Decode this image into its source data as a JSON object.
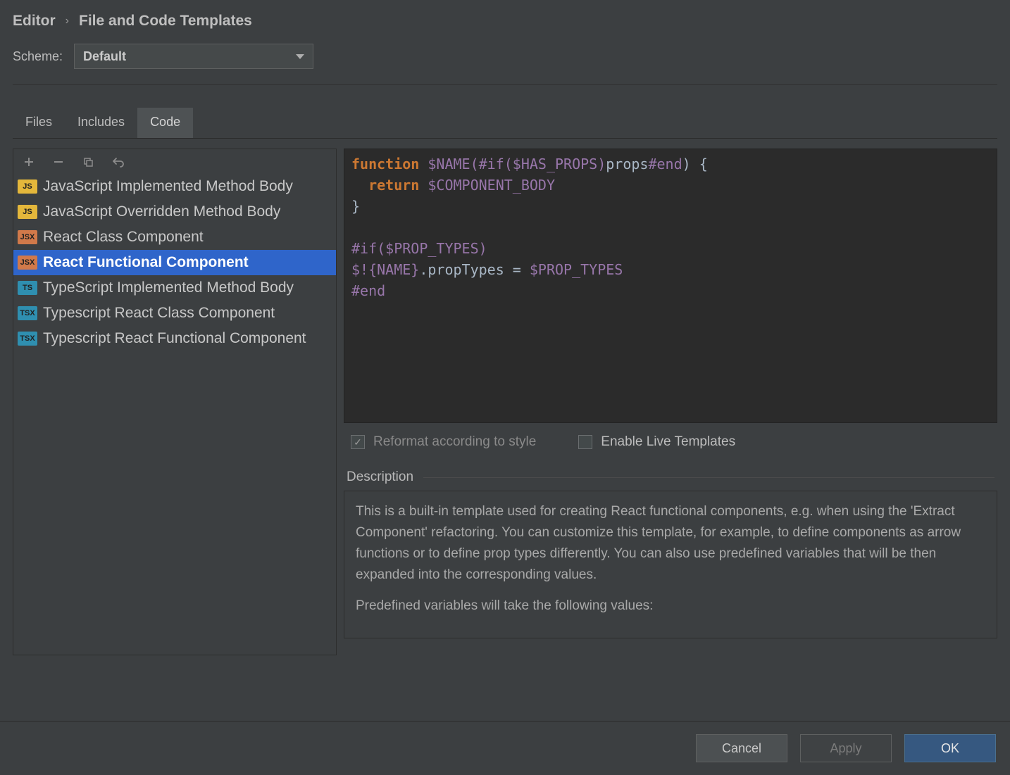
{
  "breadcrumb": {
    "root": "Editor",
    "page": "File and Code Templates"
  },
  "scheme": {
    "label": "Scheme:",
    "value": "Default"
  },
  "tabs": [
    {
      "id": "files",
      "label": "Files",
      "active": false
    },
    {
      "id": "includes",
      "label": "Includes",
      "active": false
    },
    {
      "id": "code",
      "label": "Code",
      "active": true
    }
  ],
  "toolbar_icons": [
    "add",
    "remove",
    "copy",
    "undo"
  ],
  "templates": [
    {
      "badge": "JS",
      "badgeClass": "badge-js",
      "label": "JavaScript Implemented Method Body",
      "selected": false
    },
    {
      "badge": "JS",
      "badgeClass": "badge-js",
      "label": "JavaScript Overridden Method Body",
      "selected": false
    },
    {
      "badge": "JSX",
      "badgeClass": "badge-jsx",
      "label": "React Class Component",
      "selected": false
    },
    {
      "badge": "JSX",
      "badgeClass": "badge-jsx",
      "label": "React Functional Component",
      "selected": true
    },
    {
      "badge": "TS",
      "badgeClass": "badge-ts",
      "label": "TypeScript Implemented Method Body",
      "selected": false
    },
    {
      "badge": "TSX",
      "badgeClass": "badge-tsx",
      "label": "Typescript React Class Component",
      "selected": false
    },
    {
      "badge": "TSX",
      "badgeClass": "badge-tsx",
      "label": "Typescript React Functional Component",
      "selected": false
    }
  ],
  "code": {
    "l1a": "function",
    "l1b": " $NAME(",
    "l1c": "#if($HAS_PROPS)",
    "l1d": "props",
    "l1e": "#end",
    "l1f": ") {",
    "l2a": "  return",
    "l2b": " $COMPONENT_BODY",
    "l3": "}",
    "l4": "",
    "l5": "#if($PROP_TYPES)",
    "l6a": "$!{NAME}",
    "l6b": ".propTypes = ",
    "l6c": "$PROP_TYPES",
    "l7": "#end"
  },
  "checkboxes": {
    "reformat": {
      "label": "Reformat according to style",
      "checked": true,
      "disabled": true
    },
    "livetpl": {
      "label": "Enable Live Templates",
      "checked": false,
      "disabled": false
    }
  },
  "description": {
    "title": "Description",
    "p1": "This is a built-in template used for creating React functional components, e.g. when using the 'Extract Component' refactoring. You can customize this template, for example, to define components as arrow functions or to define prop types differently. You can also use predefined variables that will be then expanded into the corresponding values.",
    "p2": "Predefined variables will take the following values:"
  },
  "buttons": {
    "cancel": "Cancel",
    "apply": "Apply",
    "ok": "OK"
  }
}
